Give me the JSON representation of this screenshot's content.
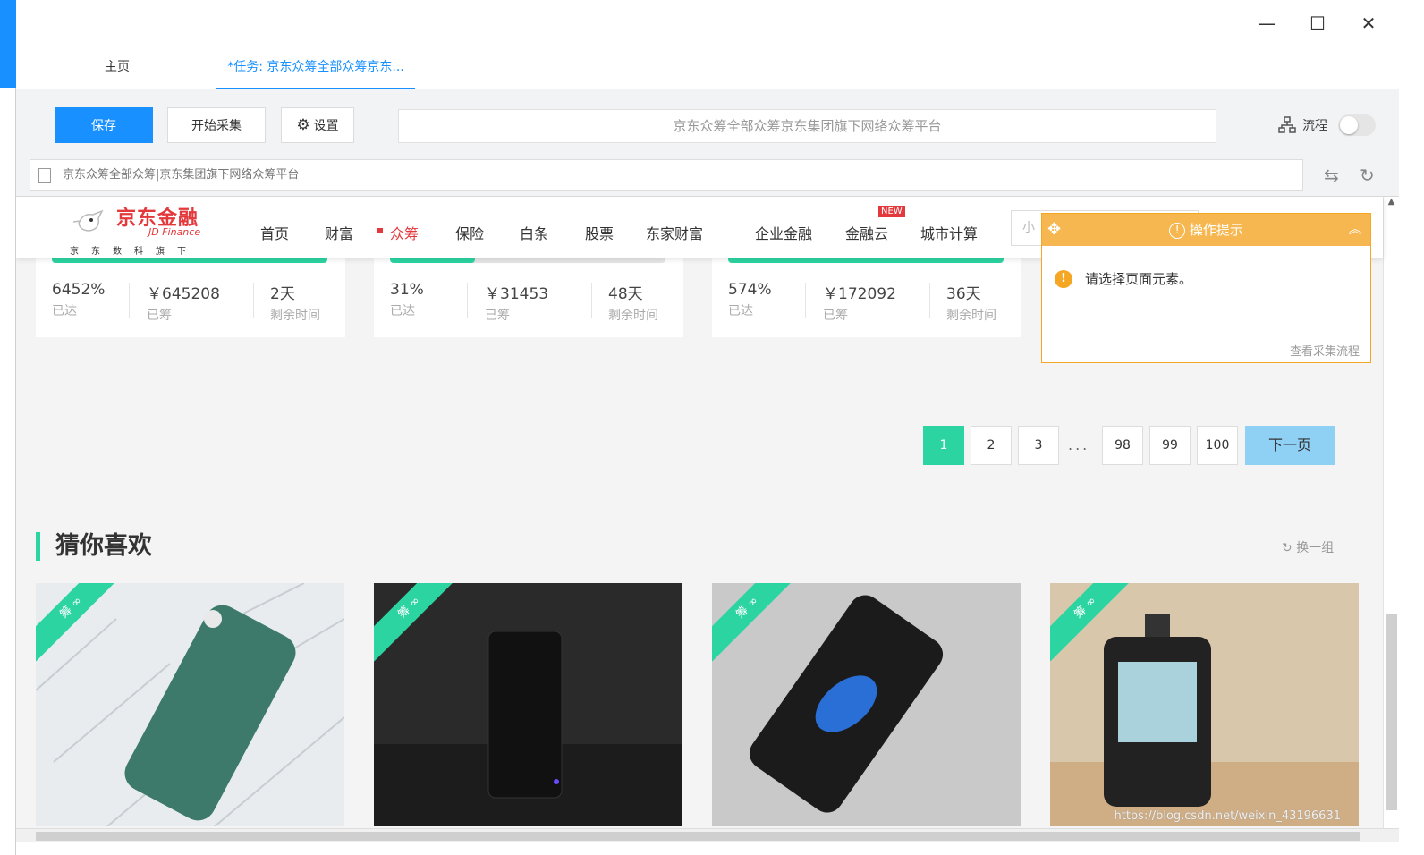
{
  "window": {
    "controls": {
      "minimize": "—",
      "maximize": "☐",
      "close": "✕"
    }
  },
  "tabs": [
    {
      "label": "主页"
    },
    {
      "label": "*任务: 京东众筹全部众筹京东..."
    }
  ],
  "toolbar": {
    "save_label": "保存",
    "start_label": "开始采集",
    "settings_label": "设置",
    "title_value": "京东众筹全部众筹京东集团旗下网络众筹平台",
    "flow_label": "流程"
  },
  "urlbar": {
    "value": "京东众筹全部众筹|京东集团旗下网络众筹平台"
  },
  "site": {
    "logo_cn": "京东金融",
    "logo_en": "JD Finance",
    "logo_sub": "京东数科旗下",
    "nav": [
      "首页",
      "财富",
      "众筹",
      "保险",
      "白条",
      "股票",
      "东家财富",
      "企业金融",
      "金融云",
      "城市计算"
    ],
    "new_badge": "NEW",
    "search_placeholder": "小"
  },
  "cards": [
    {
      "progress_pct": 100,
      "stats": [
        {
          "value": "6452%",
          "label": "已达"
        },
        {
          "value": "￥645208",
          "label": "已筹"
        },
        {
          "value": "2天",
          "label": "剩余时间"
        }
      ]
    },
    {
      "progress_pct": 31,
      "stats": [
        {
          "value": "31%",
          "label": "已达"
        },
        {
          "value": "￥31453",
          "label": "已筹"
        },
        {
          "value": "48天",
          "label": "剩余时间"
        }
      ]
    },
    {
      "progress_pct": 100,
      "stats": [
        {
          "value": "574%",
          "label": "已达"
        },
        {
          "value": "￥172092",
          "label": "已筹"
        },
        {
          "value": "36天",
          "label": "剩余时间"
        }
      ]
    }
  ],
  "tip": {
    "title": "操作提示",
    "message": "请选择页面元素。",
    "link": "查看采集流程"
  },
  "pagination": {
    "pages": [
      "1",
      "2",
      "3",
      "98",
      "99",
      "100"
    ],
    "ellipsis": "...",
    "next": "下一页",
    "current": "1"
  },
  "recommend": {
    "title": "猜你喜欢",
    "refresh": "换一组",
    "ribbon": "筹 ∞"
  },
  "watermark": "https://blog.csdn.net/weixin_43196631",
  "colors": {
    "primary": "#1890ff",
    "accent_green": "#2cd4a2",
    "jd_red": "#e4393c",
    "tip_orange": "#f7b750"
  }
}
